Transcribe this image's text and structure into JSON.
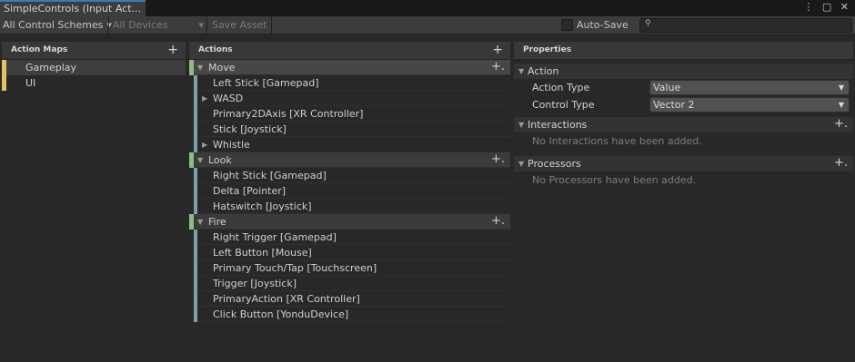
{
  "window": {
    "tab_title": "SimpleControls (Input Act...",
    "window_controls": "⋮ ▢ ✕"
  },
  "toolbar": {
    "control_schemes": "All Control Schemes",
    "devices": "All Devices",
    "save_asset": "Save Asset",
    "auto_save_label": "Auto-Save",
    "auto_save_checked": false,
    "search_value": "",
    "search_icon": "search-icon"
  },
  "action_maps": {
    "header": "Action Maps",
    "items": [
      {
        "label": "Gameplay",
        "selected": true
      },
      {
        "label": "UI",
        "selected": false
      }
    ]
  },
  "actions": {
    "header": "Actions",
    "tree": [
      {
        "label": "Move",
        "kind": "action"
      },
      {
        "label": "Left Stick [Gamepad]",
        "kind": "binding"
      },
      {
        "label": "WASD",
        "kind": "composite"
      },
      {
        "label": "Primary2DAxis [XR Controller]",
        "kind": "binding"
      },
      {
        "label": "Stick [Joystick]",
        "kind": "binding"
      },
      {
        "label": "Whistle",
        "kind": "composite"
      },
      {
        "label": "Look",
        "kind": "action"
      },
      {
        "label": "Right Stick [Gamepad]",
        "kind": "binding"
      },
      {
        "label": "Delta [Pointer]",
        "kind": "binding"
      },
      {
        "label": "Hatswitch [Joystick]",
        "kind": "binding"
      },
      {
        "label": "Fire",
        "kind": "action"
      },
      {
        "label": "Right Trigger [Gamepad]",
        "kind": "binding"
      },
      {
        "label": "Left Button [Mouse]",
        "kind": "binding"
      },
      {
        "label": "Primary Touch/Tap [Touchscreen]",
        "kind": "binding"
      },
      {
        "label": "Trigger [Joystick]",
        "kind": "binding"
      },
      {
        "label": "PrimaryAction [XR Controller]",
        "kind": "binding"
      },
      {
        "label": "Click Button [YonduDevice]",
        "kind": "binding"
      }
    ]
  },
  "properties": {
    "header": "Properties",
    "action_section": "Action",
    "action_type_label": "Action Type",
    "action_type_value": "Value",
    "control_type_label": "Control Type",
    "control_type_value": "Vector 2",
    "interactions_section": "Interactions",
    "interactions_empty": "No Interactions have been added.",
    "processors_section": "Processors",
    "processors_empty": "No Processors have been added."
  },
  "colors": {
    "map_accent": "#e0c460",
    "action_accent": "#8fbb84",
    "binding_accent": "#7aa2a2",
    "tab_accent": "#3a79bb"
  }
}
